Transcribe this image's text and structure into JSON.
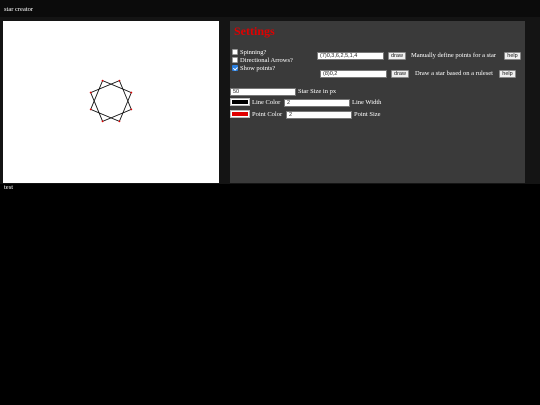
{
  "window": {
    "title": "star creator"
  },
  "settings": {
    "heading": "Settings",
    "options": [
      {
        "label": "Spinning?",
        "checked": false
      },
      {
        "label": "Directional Arrows?",
        "checked": false
      },
      {
        "label": "Show points?",
        "checked": true
      }
    ],
    "manual": {
      "value": "(7)0,3,6,2,5,1,4",
      "button": "draw",
      "description": "Manually define points for a star",
      "help": "help"
    },
    "ruleset": {
      "value": "(8)0,2",
      "button": "draw",
      "description": "Draw a star based on a ruleset",
      "help": "help"
    },
    "size": {
      "value": "50",
      "label": "Star Size in px"
    },
    "line": {
      "color_label": "Line Color",
      "color": "#000000",
      "width": "2",
      "width_label": "Line Width"
    },
    "point": {
      "color_label": "Point Color",
      "color": "#e00000",
      "size": "2",
      "size_label": "Point Size"
    }
  },
  "star": {
    "points": 8,
    "step": 2,
    "line_color": "#000000",
    "point_color": "#e00000"
  },
  "status": {
    "text": "test"
  }
}
